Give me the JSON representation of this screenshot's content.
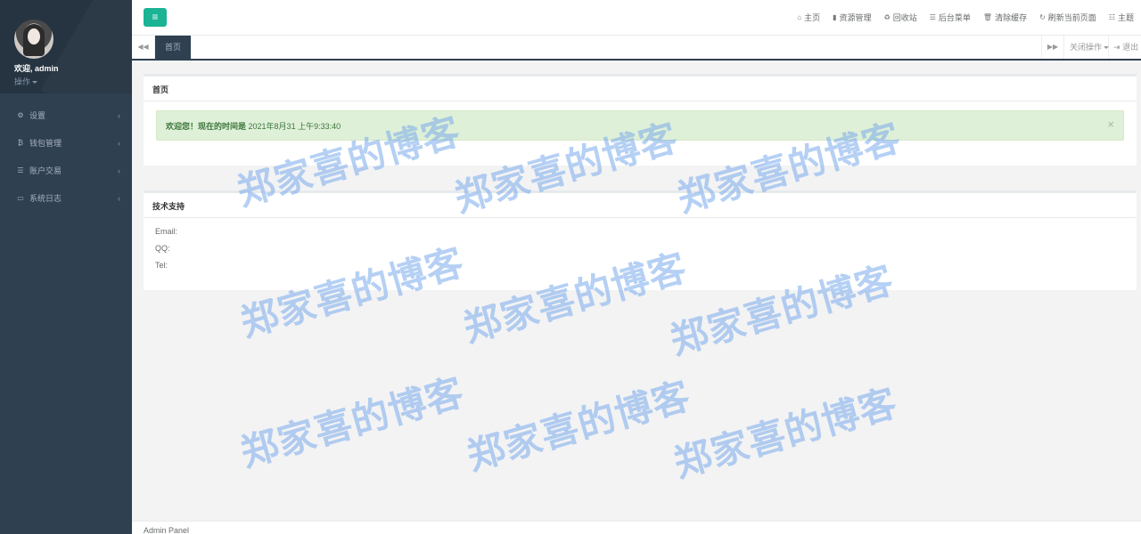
{
  "sidebar": {
    "user_greeting": "欢迎, admin",
    "user_action": "操作",
    "items": [
      {
        "label": "设置",
        "icon": "gears-icon",
        "glyph": "⚙"
      },
      {
        "label": "钱包管理",
        "icon": "bitcoin-icon",
        "glyph": "₿"
      },
      {
        "label": "账户交易",
        "icon": "list-icon",
        "glyph": "☰"
      },
      {
        "label": "系统日志",
        "icon": "desktop-icon",
        "glyph": "▭"
      }
    ]
  },
  "topbar": {
    "menu_toggle_glyph": "≡",
    "links": [
      {
        "label": "主页",
        "icon": "home-icon",
        "glyph": "⌂"
      },
      {
        "label": "资源管理",
        "icon": "file-icon",
        "glyph": "▮"
      },
      {
        "label": "回收站",
        "icon": "recycle-icon",
        "glyph": "♻"
      },
      {
        "label": "后台菜单",
        "icon": "list-icon",
        "glyph": "☰"
      },
      {
        "label": "清除缓存",
        "icon": "trash-icon",
        "glyph": "🗑"
      },
      {
        "label": "刷新当前页面",
        "icon": "refresh-icon",
        "glyph": "↻"
      },
      {
        "label": "主题",
        "icon": "theme-icon",
        "glyph": "☷"
      }
    ]
  },
  "tabs": {
    "prev_glyph": "◀◀",
    "active": "首页",
    "next_glyph": "▶▶",
    "close_ops": "关闭操作",
    "logout": "退出"
  },
  "home_panel": {
    "title": "首页",
    "alert_prefix": "欢迎您！现在的时间是",
    "alert_time": "2021年8月31 上午9:33:40",
    "close_glyph": "×"
  },
  "support_panel": {
    "title": "技术支持",
    "email": "Email:",
    "qq": "QQ:",
    "tel": "Tel:"
  },
  "footer": {
    "text": "Admin Panel"
  },
  "watermark": {
    "text": "郑家喜的博客"
  }
}
